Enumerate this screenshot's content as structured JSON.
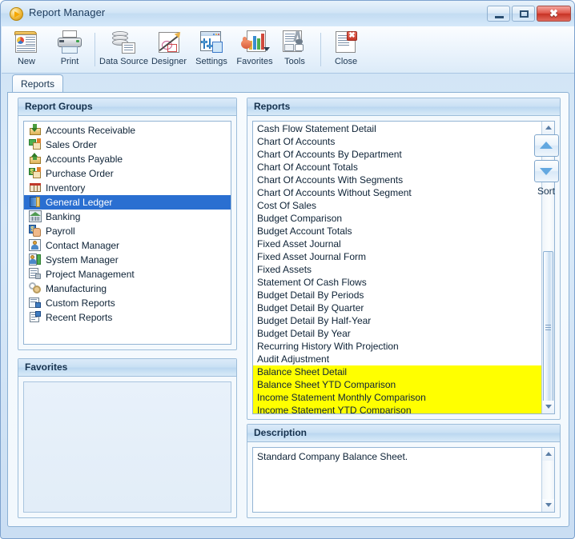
{
  "window": {
    "title": "Report Manager",
    "icon": "play-circle-icon",
    "buttons": {
      "minimize": "minimize-icon",
      "maximize": "maximize-icon",
      "close": "✖"
    }
  },
  "toolbar": {
    "items": [
      {
        "label": "New",
        "icon": "new-report-icon"
      },
      {
        "label": "Print",
        "icon": "printer-icon"
      },
      {
        "label": "Data Source",
        "icon": "database-icon"
      },
      {
        "label": "Designer",
        "icon": "designer-pencil-icon"
      },
      {
        "label": "Settings",
        "icon": "settings-window-icon"
      },
      {
        "label": "Favorites",
        "icon": "favorites-chart-icon"
      },
      {
        "label": "Tools",
        "icon": "tools-wrench-icon"
      },
      {
        "label": "Close",
        "icon": "close-document-icon"
      }
    ]
  },
  "tabs": [
    {
      "label": "Reports",
      "active": true
    }
  ],
  "report_groups": {
    "header": "Report Groups",
    "items": [
      {
        "label": "Accounts Receivable",
        "icon": "ar-envelope-down-icon",
        "selected": false
      },
      {
        "label": "Sales Order",
        "icon": "sales-order-box-icon",
        "selected": false
      },
      {
        "label": "Accounts Payable",
        "icon": "ap-envelope-up-icon",
        "selected": false
      },
      {
        "label": "Purchase Order",
        "icon": "purchase-order-box-icon",
        "selected": false
      },
      {
        "label": "Inventory",
        "icon": "inventory-grid-icon",
        "selected": false
      },
      {
        "label": "General Ledger",
        "icon": "general-ledger-book-icon",
        "selected": true
      },
      {
        "label": "Banking",
        "icon": "bank-building-icon",
        "selected": false
      },
      {
        "label": "Payroll",
        "icon": "payroll-hand-icon",
        "selected": false
      },
      {
        "label": "Contact Manager",
        "icon": "contact-person-icon",
        "selected": false
      },
      {
        "label": "System Manager",
        "icon": "system-manager-icon",
        "selected": false
      },
      {
        "label": "Project Management",
        "icon": "project-management-icon",
        "selected": false
      },
      {
        "label": "Manufacturing",
        "icon": "manufacturing-gear-icon",
        "selected": false
      },
      {
        "label": "Custom Reports",
        "icon": "custom-reports-icon",
        "selected": false
      },
      {
        "label": "Recent Reports",
        "icon": "recent-reports-icon",
        "selected": false
      }
    ]
  },
  "favorites": {
    "header": "Favorites",
    "items": []
  },
  "reports": {
    "header": "Reports",
    "items": [
      {
        "label": "Cash Flow Statement Detail",
        "highlighted": false
      },
      {
        "label": "Chart Of Accounts",
        "highlighted": false
      },
      {
        "label": "Chart Of Accounts By Department",
        "highlighted": false
      },
      {
        "label": "Chart Of Account Totals",
        "highlighted": false
      },
      {
        "label": "Chart Of Accounts With Segments",
        "highlighted": false
      },
      {
        "label": "Chart Of Accounts Without Segment",
        "highlighted": false
      },
      {
        "label": "Cost Of Sales",
        "highlighted": false
      },
      {
        "label": "Budget Comparison",
        "highlighted": false
      },
      {
        "label": "Budget Account Totals",
        "highlighted": false
      },
      {
        "label": "Fixed Asset Journal",
        "highlighted": false
      },
      {
        "label": "Fixed Asset Journal Form",
        "highlighted": false
      },
      {
        "label": "Fixed Assets",
        "highlighted": false
      },
      {
        "label": "Statement Of Cash Flows",
        "highlighted": false
      },
      {
        "label": "Budget Detail By Periods",
        "highlighted": false
      },
      {
        "label": "Budget Detail By Quarter",
        "highlighted": false
      },
      {
        "label": "Budget Detail By Half-Year",
        "highlighted": false
      },
      {
        "label": "Budget Detail By Year",
        "highlighted": false
      },
      {
        "label": "Recurring History With Projection",
        "highlighted": false
      },
      {
        "label": "Audit Adjustment",
        "highlighted": false
      },
      {
        "label": "Balance Sheet Detail",
        "highlighted": true
      },
      {
        "label": "Balance Sheet YTD Comparison",
        "highlighted": true
      },
      {
        "label": "Income Statement Monthly Comparison",
        "highlighted": true
      },
      {
        "label": "Income Statement YTD Comparison",
        "highlighted": true
      }
    ],
    "highlight_color": "#ffff00"
  },
  "sort": {
    "label": "Sort",
    "up_icon": "sort-ascending-icon",
    "down_icon": "sort-descending-icon"
  },
  "description": {
    "header": "Description",
    "text": "Standard Company Balance Sheet."
  },
  "colors": {
    "selection": "#2a6fd1",
    "highlight": "#ffff00",
    "accent": "#8bb0d4"
  }
}
